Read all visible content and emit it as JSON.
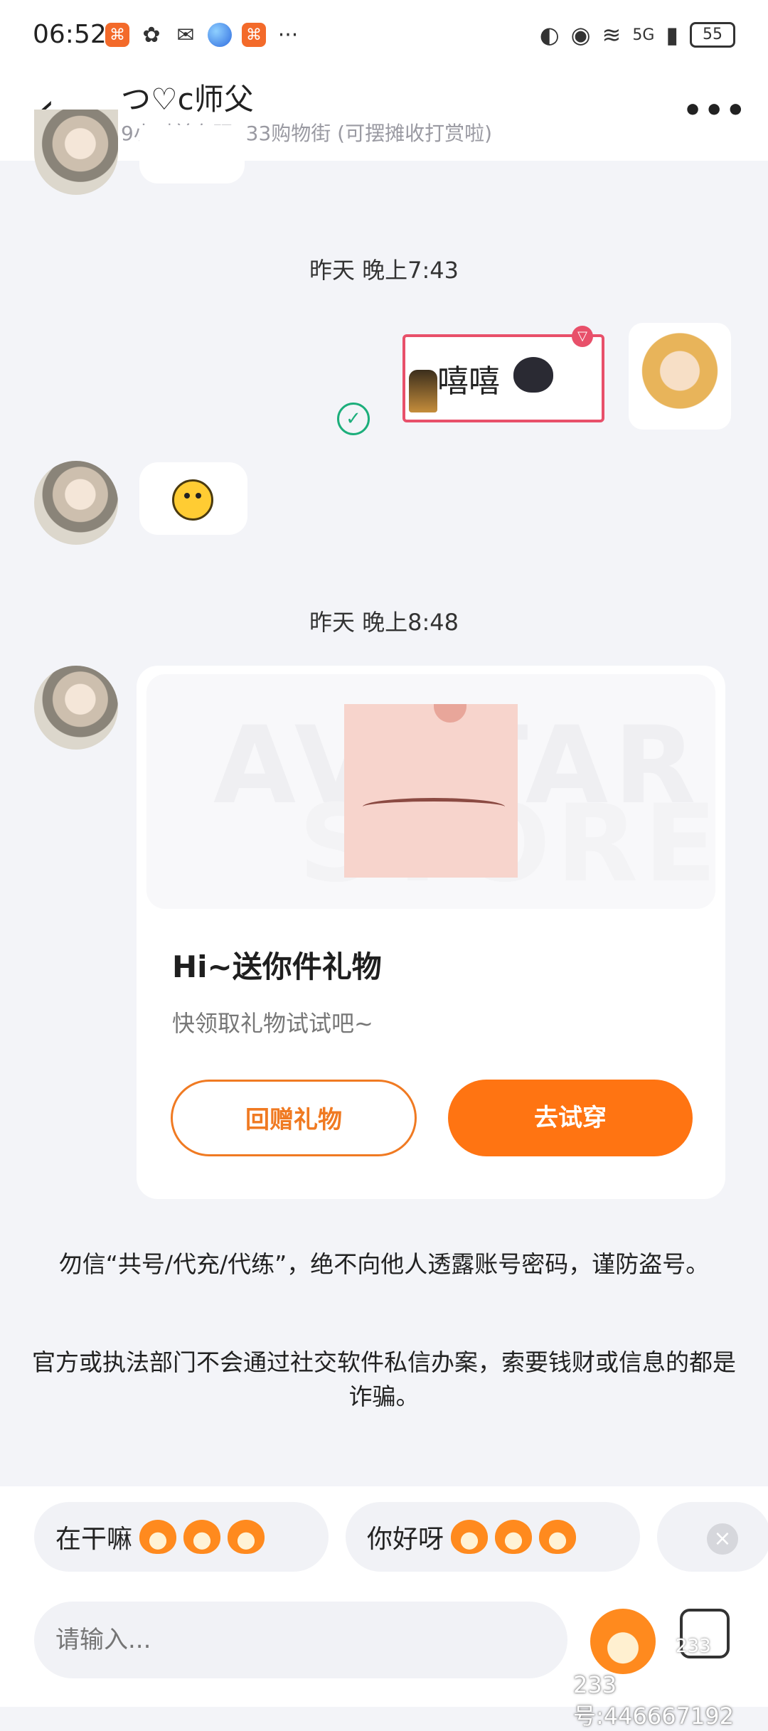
{
  "status_bar": {
    "time": "06:52",
    "more_glyph": "···",
    "network": "5G",
    "battery": "55"
  },
  "header": {
    "title": "つ♡c师父",
    "subtitle": "9小时前在玩233购物街 (可摆摊收打赏啦)",
    "back_icon": "‹",
    "more_icon": "•••"
  },
  "messages": {
    "time_1": "昨天 晚上7:43",
    "sticker_text": "嘻嘻",
    "time_2": "昨天 晚上8:48"
  },
  "gift_card": {
    "watermark_1": "AVATAR",
    "watermark_2": "STORE",
    "title": "Hi~送你件礼物",
    "description": "快领取礼物试试吧~",
    "return_gift_button": "回赠礼物",
    "try_on_button": "去试穿"
  },
  "notices": {
    "notice_1": "勿信“共号/代充/代练”，绝不向他人透露账号密码，谨防盗号。",
    "notice_2": "官方或执法部门不会通过社交软件私信办案，索要钱财或信息的都是诈骗。"
  },
  "quick_replies": [
    {
      "label": "在干嘛"
    },
    {
      "label": "你好呀"
    }
  ],
  "input": {
    "placeholder": "请输入..."
  },
  "footer": {
    "account_id": "233号:446667192",
    "watermark": "233"
  },
  "colors": {
    "accent": "#ff7412",
    "online_check": "#1cae7b",
    "sticker_border": "#e8506a"
  }
}
